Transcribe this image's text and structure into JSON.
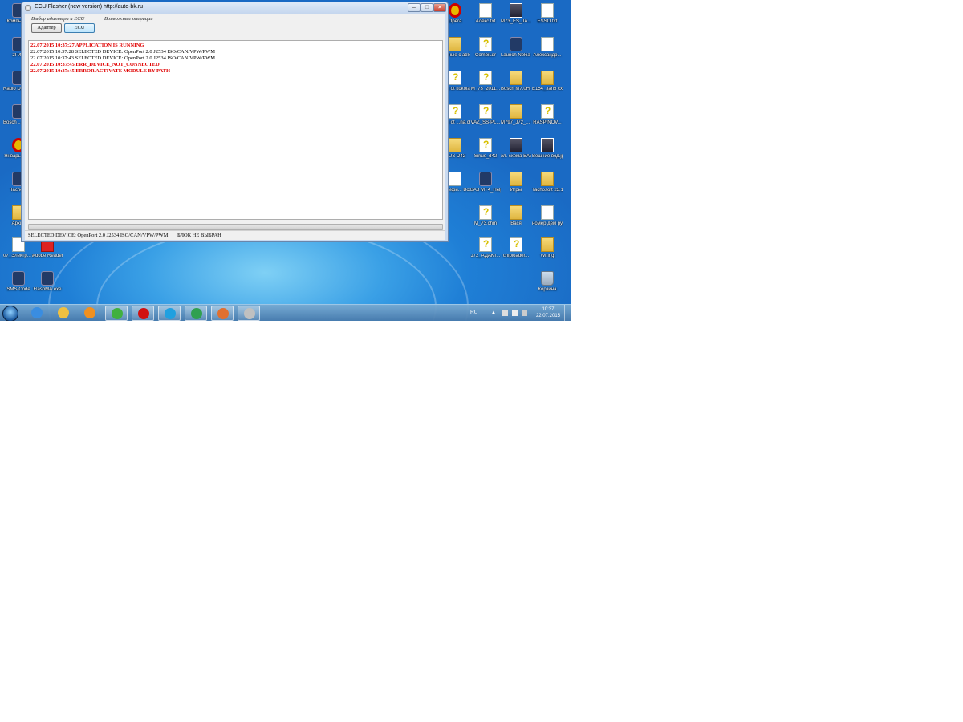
{
  "window": {
    "title": "ECU Flasher (new version)  http://auto-bk.ru",
    "minimize": "–",
    "maximize": "□",
    "close": "×",
    "menus": [
      "Выбор адаптера и ECU",
      "Возможные операции"
    ],
    "buttons": {
      "adapter": "Адаптер",
      "ecu": "ECU"
    },
    "log": [
      {
        "text": "22.07.2015 10:37:27 APPLICATION IS RUNNING",
        "level": "err"
      },
      {
        "text": "22.07.2015 10:37:28 SELECTED DEVICE: OpenPort 2.0 J2534 ISO/CAN/VPW/PWM",
        "level": "info"
      },
      {
        "text": "22.07.2015 10:37:43 SELECTED DEVICE: OpenPort 2.0 J2534 ISO/CAN/VPW/PWM",
        "level": "info"
      },
      {
        "text": "22.07.2015 10:37:45 ERR_DEVICE_NOT_CONNECTED",
        "level": "err"
      },
      {
        "text": "22.07.2015 10:37:45 ERROR ACTIVATE MODULE BY PATH",
        "level": "err"
      }
    ],
    "progress": 0,
    "status": {
      "device": "SELECTED DEVICE: OpenPort 2.0 J2534 ISO/CAN/VPW/PWM",
      "block": "БЛОК НЕ ВЫБРАН"
    }
  },
  "desktop_left": [
    {
      "label": "Компьют...",
      "icon": "computer-icon"
    },
    {
      "label": "2ГИС",
      "icon": "2gis-icon"
    },
    {
      "label": "Radio Decoder",
      "icon": "radio-decoder-icon"
    },
    {
      "label": "Bosch ... mod...",
      "icon": "bosch-app-icon"
    },
    {
      "label": "Январь 4/5.1",
      "icon": "ring-icon"
    },
    {
      "label": "Tacho...",
      "icon": "tachosoft-icon"
    },
    {
      "label": "Архив",
      "icon": "folder-icon"
    },
    {
      "label": "07_Электр... система у...",
      "icon": "document-icon"
    },
    {
      "label": "Adobe Reader X",
      "icon": "adobe-reader-icon"
    },
    {
      "label": "SMS-Code",
      "icon": "sms-code-icon"
    },
    {
      "label": "FlashMA.exe",
      "icon": "flashma-icon"
    }
  ],
  "desktop_right": [
    {
      "label": "Opera",
      "icon": "opera-icon"
    },
    {
      "label": "Алекс.txt",
      "icon": "text-file-icon"
    },
    {
      "label": "M73_ES_JA...",
      "icon": "image-file-icon"
    },
    {
      "label": "ESSO.txt",
      "icon": "text-file-icon"
    },
    {
      "label": "Данные с авто",
      "icon": "folder-icon"
    },
    {
      "label": "CombiLdr",
      "icon": "help-file-icon"
    },
    {
      "label": "Launch Nokia Ca...",
      "icon": "nokia-icon"
    },
    {
      "label": "Александр...",
      "icon": "text-file-icon"
    },
    {
      "label": "prog ot kokola...",
      "icon": "help-file-icon"
    },
    {
      "label": "M_73_2011...",
      "icon": "help-file-icon"
    },
    {
      "label": "Bosch M7.0H сх...",
      "icon": "folder-icon"
    },
    {
      "label": "E154_Jan5 схема эле...",
      "icon": "folder-icon"
    },
    {
      "label": "prog ot ...na.chm",
      "icon": "help-file-icon"
    },
    {
      "label": "VAZ_SS-PL...",
      "icon": "help-file-icon"
    },
    {
      "label": "M797_J72_... схема эле...",
      "icon": "folder-icon"
    },
    {
      "label": "RASPINOV...",
      "icon": "help-file-icon"
    },
    {
      "label": "...US D42",
      "icon": "folder-icon"
    },
    {
      "label": "Sirius_d42",
      "icon": "help-file-icon"
    },
    {
      "label": "эл. схема ВАЗ 21...",
      "icon": "image-file-icon"
    },
    {
      "label": "Вешние вод.jpg",
      "icon": "image-file-icon"
    },
    {
      "label": "...нтифи... Bosch ...",
      "icon": "document-icon"
    },
    {
      "label": "ВАЗ MT4_Help...",
      "icon": "book-icon"
    },
    {
      "label": "Игры",
      "icon": "folder-icon"
    },
    {
      "label": "Tachosoft 23.1",
      "icon": "folder-icon"
    },
    {
      "label": "M_73.chm",
      "icon": "help-file-icon"
    },
    {
      "label": "Вася",
      "icon": "folder-icon"
    },
    {
      "label": "номер дем ру.txt",
      "icon": "text-file-icon"
    },
    {
      "label": "J72_АДАКТ...",
      "icon": "help-file-icon"
    },
    {
      "label": "chiploader...",
      "icon": "help-file-icon"
    },
    {
      "label": "Wiring",
      "icon": "folder-icon"
    },
    {
      "label": "Корзина",
      "icon": "recycle-bin-icon"
    }
  ],
  "taskbar": {
    "items": [
      "internet-explorer-icon",
      "explorer-icon",
      "media-player-icon",
      "icq-icon",
      "opera-icon",
      "skype-icon",
      "tool-icon",
      "app-icon",
      "ecu-flasher-icon"
    ],
    "lang": "RU",
    "time": "10:37",
    "date": "22.07.2015"
  },
  "colors": {
    "error": "#e00000",
    "desktop": "#1f7fd6"
  }
}
